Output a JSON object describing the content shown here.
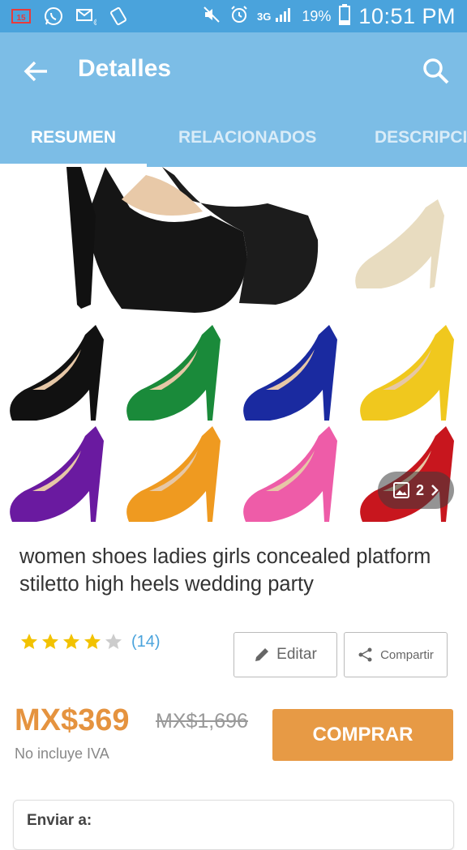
{
  "status_bar": {
    "time": "10:51 PM",
    "battery": "19%",
    "network": "3G"
  },
  "app_bar": {
    "title": "Detalles"
  },
  "tabs": [
    {
      "label": "RESUMEN",
      "active": true
    },
    {
      "label": "RELACIONADOS",
      "active": false
    },
    {
      "label": "DESCRIPCIÓN",
      "active": false
    }
  ],
  "gallery": {
    "count": "2",
    "shoe_colors": [
      "#111111",
      "#e8dcc0",
      "#111111",
      "#1a8a3a",
      "#1a2aa0",
      "#f0c81e",
      "#6a1aa0",
      "#ef9a20",
      "#ee5ca8",
      "#c8161e"
    ]
  },
  "product": {
    "title": "women shoes ladies girls concealed platform stiletto high heels wedding party",
    "rating": 4,
    "reviews": "(14)",
    "price": "MX$369",
    "old_price": "MX$1,696",
    "tax_note": "No incluye IVA"
  },
  "actions": {
    "edit": "Editar",
    "share": "Compartir",
    "buy": "COMPRAR"
  },
  "shipping": {
    "label": "Enviar a:"
  },
  "colors": {
    "status_bar": "#4aa3dc",
    "app_bar": "#7cbde6",
    "accent": "#e79a45"
  }
}
